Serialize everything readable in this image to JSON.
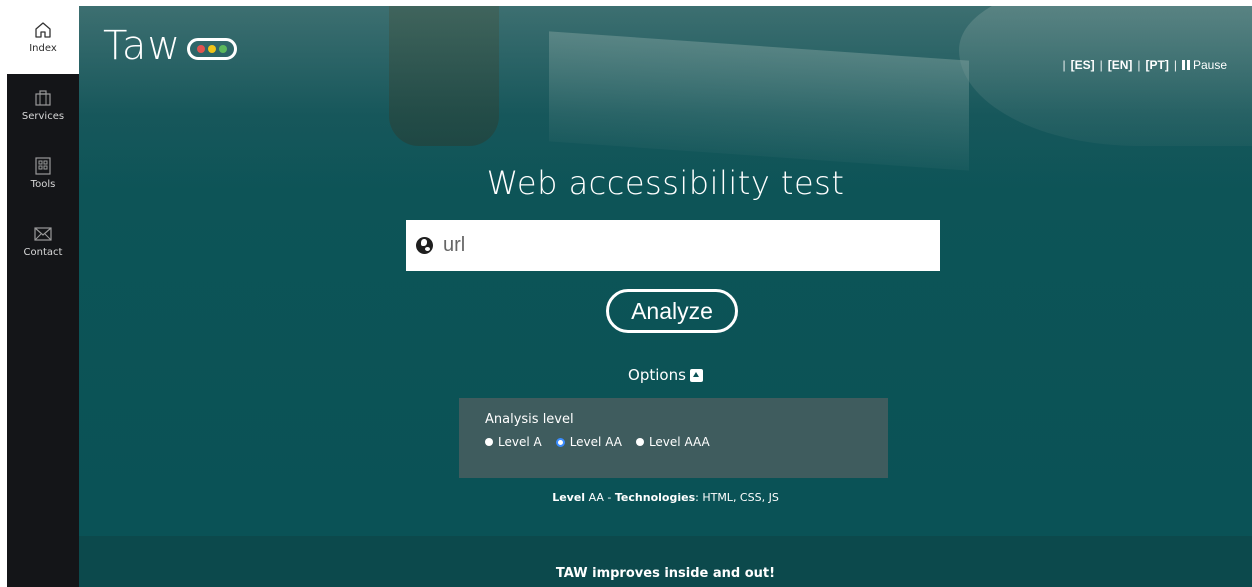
{
  "sidebar": {
    "items": [
      {
        "label": "Index",
        "icon": "home-icon",
        "active": true
      },
      {
        "label": "Services",
        "icon": "briefcase-icon",
        "active": false
      },
      {
        "label": "Tools",
        "icon": "tools-grid-icon",
        "active": false
      },
      {
        "label": "Contact",
        "icon": "envelope-icon",
        "active": false
      }
    ]
  },
  "header": {
    "logo_text": "Taw",
    "logo_lights": [
      "#e1534f",
      "#f0c419",
      "#5cb85c"
    ],
    "languages": [
      "[ES]",
      "[EN]",
      "[PT]"
    ],
    "separator": "|",
    "pause_label": "Pause"
  },
  "main": {
    "title": "Web accessibility test",
    "url_placeholder": "url",
    "analyze_label": "Analyze",
    "options_label": "Options",
    "analysis_level_label": "Analysis level",
    "levels": [
      {
        "label": "Level A",
        "selected": false
      },
      {
        "label": "Level AA",
        "selected": true
      },
      {
        "label": "Level AAA",
        "selected": false
      }
    ],
    "summary": {
      "level_word": "Level",
      "level_value": "AA",
      "dash": " - ",
      "tech_word": "Technologies",
      "tech_value": ": HTML, CSS, JS"
    }
  },
  "footer": {
    "tagline": "TAW improves inside and out!"
  },
  "colors": {
    "sidebar_bg": "#141518",
    "hero_bg": "#0a5256",
    "options_panel_bg": "#3f5c5e",
    "footer_bg": "#0c494c",
    "radio_selected": "#3a8cff"
  }
}
